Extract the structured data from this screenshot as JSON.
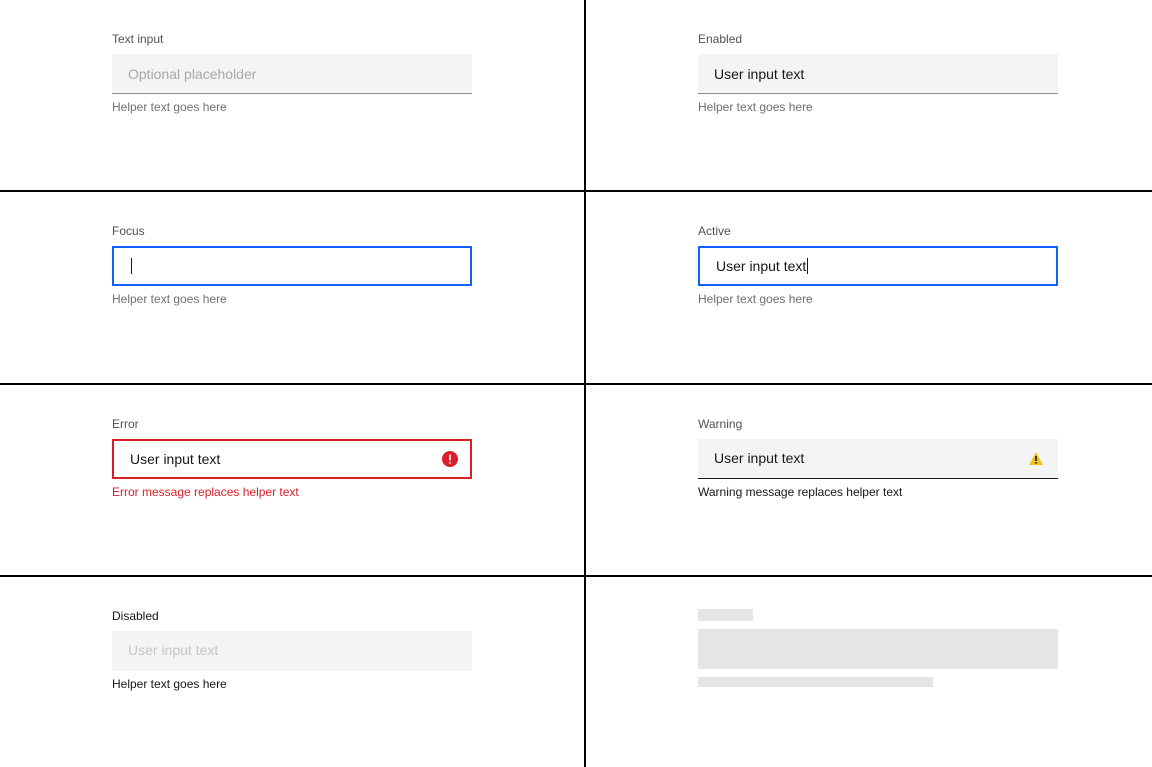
{
  "states": {
    "default": {
      "label": "Text input",
      "placeholder": "Optional placeholder",
      "helper": "Helper text goes here"
    },
    "enabled": {
      "label": "Enabled",
      "value": "User input text",
      "helper": "Helper text goes here"
    },
    "focus": {
      "label": "Focus",
      "value": "",
      "helper": "Helper text goes here"
    },
    "active": {
      "label": "Active",
      "value": "User input text",
      "helper": "Helper text goes here"
    },
    "error": {
      "label": "Error",
      "value": "User input text",
      "helper": "Error message replaces helper text"
    },
    "warning": {
      "label": "Warning",
      "value": "User input text",
      "helper": "Warning message replaces helper text"
    },
    "disabled": {
      "label": "Disabled",
      "value": "User input text",
      "helper": "Helper text goes here"
    }
  }
}
